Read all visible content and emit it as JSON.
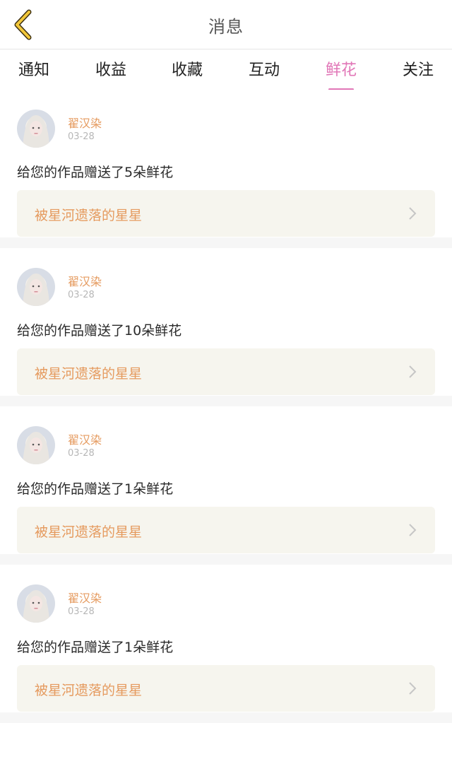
{
  "header": {
    "title": "消息"
  },
  "tabs": [
    {
      "label": "通知"
    },
    {
      "label": "收益"
    },
    {
      "label": "收藏"
    },
    {
      "label": "互动"
    },
    {
      "label": "鲜花"
    },
    {
      "label": "关注"
    }
  ],
  "active_tab": "鲜花",
  "colors": {
    "active_tab": "#e176b7",
    "accent": "#e59a5e",
    "link_bg": "#f6f5ee"
  },
  "items": [
    {
      "user": "翟汉染",
      "date": "03-28",
      "message": "给您的作品赠送了5朵鲜花",
      "work_title": "被星河遗落的星星"
    },
    {
      "user": "翟汉染",
      "date": "03-28",
      "message": "给您的作品赠送了10朵鲜花",
      "work_title": "被星河遗落的星星"
    },
    {
      "user": "翟汉染",
      "date": "03-28",
      "message": "给您的作品赠送了1朵鲜花",
      "work_title": "被星河遗落的星星"
    },
    {
      "user": "翟汉染",
      "date": "03-28",
      "message": "给您的作品赠送了1朵鲜花",
      "work_title": "被星河遗落的星星"
    }
  ]
}
